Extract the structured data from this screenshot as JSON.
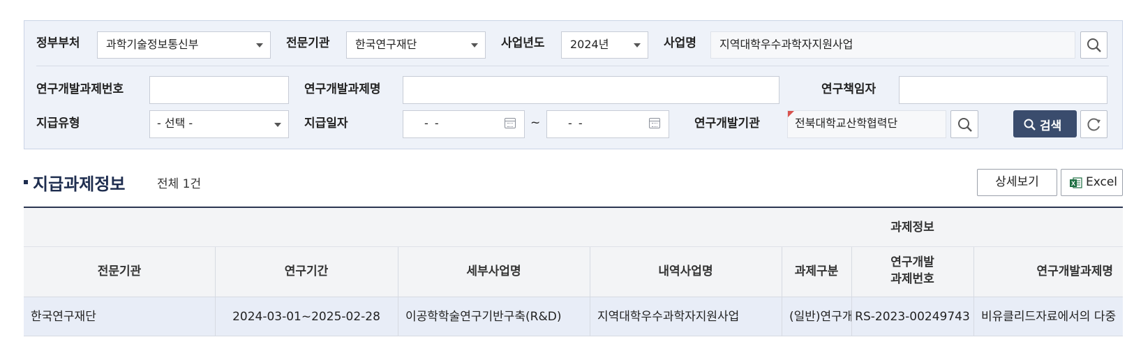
{
  "filters": {
    "gov_ministry": {
      "label": "정부부처",
      "value": "과학기술정보통신부"
    },
    "agency": {
      "label": "전문기관",
      "value": "한국연구재단"
    },
    "year": {
      "label": "사업년도",
      "value": "2024년"
    },
    "program": {
      "label": "사업명",
      "value": "지역대학우수과학자지원사업"
    },
    "task_number": {
      "label": "연구개발과제번호",
      "value": ""
    },
    "task_name": {
      "label": "연구개발과제명",
      "value": ""
    },
    "pi": {
      "label": "연구책임자",
      "value": ""
    },
    "pay_type": {
      "label": "지급유형",
      "value": "- 선택 -"
    },
    "pay_date": {
      "label": "지급일자",
      "from": "- -",
      "to": "- -",
      "sep": "~"
    },
    "institution": {
      "label": "연구개발기관",
      "value": "전북대학교산학협력단"
    },
    "search_button": "검색"
  },
  "section": {
    "title": "지급과제정보",
    "total": "전체 1건",
    "detail_button": "상세보기",
    "excel_button": "Excel"
  },
  "table": {
    "group_header": "과제정보",
    "columns": [
      "전문기관",
      "연구기간",
      "세부사업명",
      "내역사업명",
      "과제구분",
      "연구개발",
      "과제번호",
      "연구개발과제명"
    ],
    "rows": [
      {
        "agency": "한국연구재단",
        "period": "2024-03-01~2025-02-28",
        "sub_program": "이공학학술연구기반구축(R&D)",
        "detail_program": "지역대학우수과학자지원사업",
        "category": "(일반)연구개",
        "task_no": "RS-2023-00249743",
        "task_name": "비유클리드자료에서의 다중"
      }
    ]
  },
  "colors": {
    "accent": "#3a4c6d",
    "title": "#1e2d4f",
    "panel_bg": "#eef2f9",
    "row_highlight": "#e8edf7"
  }
}
